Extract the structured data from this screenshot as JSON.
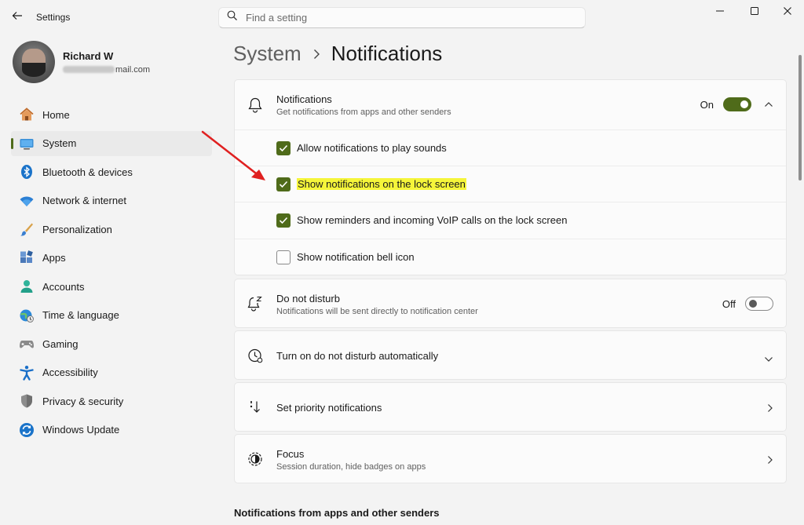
{
  "window": {
    "title": "Settings",
    "back_icon": "arrow-left-icon",
    "controls": [
      "minimize-icon",
      "maximize-icon",
      "close-icon"
    ]
  },
  "search": {
    "placeholder": "Find a setting",
    "value": ""
  },
  "profile": {
    "name": "Richard W",
    "email_visible_suffix": "mail.com"
  },
  "sidebar": {
    "items": [
      {
        "label": "Home",
        "icon": "home-icon",
        "active": false
      },
      {
        "label": "System",
        "icon": "system-monitor-icon",
        "active": true
      },
      {
        "label": "Bluetooth & devices",
        "icon": "bluetooth-icon",
        "active": false
      },
      {
        "label": "Network & internet",
        "icon": "wifi-icon",
        "active": false
      },
      {
        "label": "Personalization",
        "icon": "brush-icon",
        "active": false
      },
      {
        "label": "Apps",
        "icon": "apps-icon",
        "active": false
      },
      {
        "label": "Accounts",
        "icon": "accounts-icon",
        "active": false
      },
      {
        "label": "Time & language",
        "icon": "globe-clock-icon",
        "active": false
      },
      {
        "label": "Gaming",
        "icon": "gamepad-icon",
        "active": false
      },
      {
        "label": "Accessibility",
        "icon": "accessibility-icon",
        "active": false
      },
      {
        "label": "Privacy & security",
        "icon": "shield-icon",
        "active": false
      },
      {
        "label": "Windows Update",
        "icon": "windows-update-icon",
        "active": false
      }
    ]
  },
  "breadcrumb": {
    "parent": "System",
    "current": "Notifications"
  },
  "notifications": {
    "title": "Notifications",
    "subtitle": "Get notifications from apps and other senders",
    "state_label": "On",
    "enabled": true,
    "options": [
      {
        "label": "Allow notifications to play sounds",
        "checked": true,
        "highlighted": false
      },
      {
        "label": "Show notifications on the lock screen",
        "checked": true,
        "highlighted": true
      },
      {
        "label": "Show reminders and incoming VoIP calls on the lock screen",
        "checked": true,
        "highlighted": false
      },
      {
        "label": "Show notification bell icon",
        "checked": false,
        "highlighted": false
      }
    ]
  },
  "do_not_disturb": {
    "title": "Do not disturb",
    "subtitle": "Notifications will be sent directly to notification center",
    "state_label": "Off",
    "enabled": false
  },
  "dnd_auto": {
    "title": "Turn on do not disturb automatically"
  },
  "priority": {
    "title": "Set priority notifications"
  },
  "focus": {
    "title": "Focus",
    "subtitle": "Session duration, hide badges on apps"
  },
  "section_heading": "Notifications from apps and other senders",
  "colors": {
    "accent": "#4f6b1a",
    "highlight": "#f5f53a",
    "annotation_arrow": "#e02020"
  }
}
